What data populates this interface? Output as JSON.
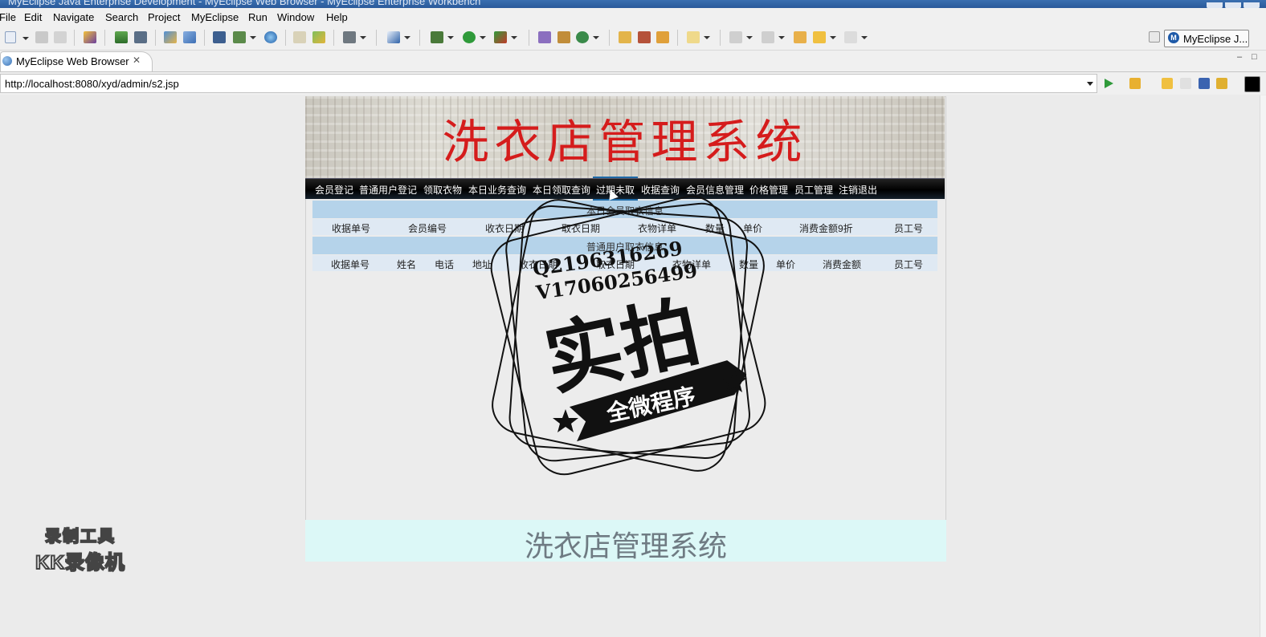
{
  "window": {
    "title": "MyEclipse Java Enterprise Development - MyEclipse Web Browser - MyEclipse Enterprise Workbench"
  },
  "menu": [
    "File",
    "Edit",
    "Navigate",
    "Search",
    "Project",
    "MyEclipse",
    "Run",
    "Window",
    "Help"
  ],
  "perspective": {
    "label": "MyEclipse J...",
    "icon": "myeclipse-icon"
  },
  "view_tab": {
    "label": "MyEclipse Web Browser",
    "icon": "globe-icon",
    "close_icon": "close-icon"
  },
  "address": {
    "url": "http://localhost:8080/xyd/admin/s2.jsp"
  },
  "page": {
    "banner_title": "洗衣店管理系统",
    "nav": [
      "会员登记",
      "普通用户登记",
      "领取衣物",
      "本日业务查询",
      "本日领取查询",
      "过期未取",
      "收据查询",
      "会员信息管理",
      "价格管理",
      "员工管理",
      "注销退出"
    ],
    "active_nav": "过期未取",
    "section1": {
      "title": "本日会员取衣信息",
      "headers": [
        "收据单号",
        "会员编号",
        "收衣日期",
        "取衣日期",
        "衣物详单",
        "数量",
        "单价",
        "消费金额9折",
        "员工号"
      ]
    },
    "section2": {
      "title": "普通用户取衣信息",
      "headers": [
        "收据单号",
        "姓名",
        "电话",
        "地址",
        "收衣日期",
        "取衣日期",
        "衣物详单",
        "数量",
        "单价",
        "消费金额",
        "员工号"
      ]
    },
    "footer": "洗衣店管理系统"
  },
  "overlay_stamp": {
    "line1": "Q2196316269",
    "line2": "V17060256499",
    "main": "实拍",
    "ribbon": "全微程序"
  },
  "recorder": {
    "line1": "录制工具",
    "line2": "KK录像机"
  }
}
